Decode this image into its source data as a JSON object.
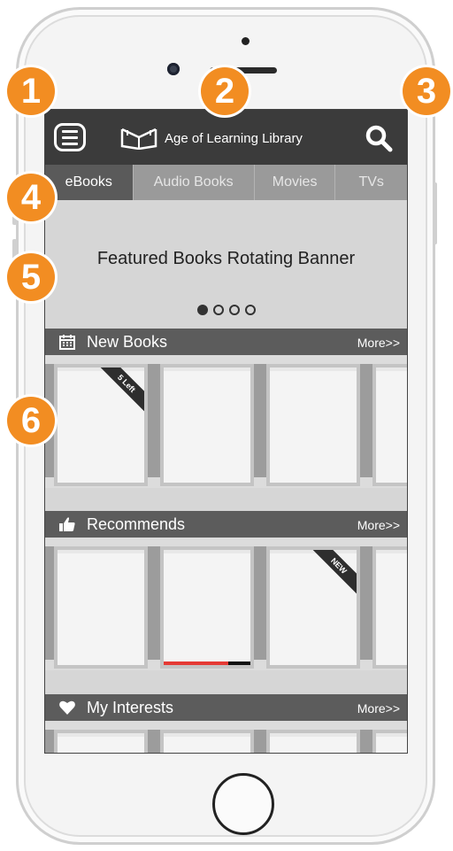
{
  "annotations": {
    "one": "1",
    "two": "2",
    "three": "3",
    "four": "4",
    "five": "5",
    "six": "6"
  },
  "header": {
    "title": "Age of Learning Library",
    "menu_icon": "hamburger-menu-icon",
    "logo_icon": "open-book-logo-icon",
    "search_icon": "search-icon"
  },
  "tabs": [
    {
      "label": "eBooks",
      "active": true
    },
    {
      "label": "Audio Books",
      "active": false
    },
    {
      "label": "Movies",
      "active": false
    },
    {
      "label": "TVs",
      "active": false
    }
  ],
  "banner": {
    "text": "Featured Books Rotating Banner",
    "slide_count": 4,
    "active_slide": 1
  },
  "sections": {
    "new_books": {
      "title": "New Books",
      "more": "More>>",
      "icon": "calendar-icon",
      "ribbon": "5 Left"
    },
    "recommends": {
      "title": "Recommends",
      "more": "More>>",
      "icon": "thumbs-up-icon",
      "ribbon": "NEW",
      "progress": 0.7
    },
    "my_interests": {
      "title": "My Interests",
      "more": "More>>",
      "icon": "heart-icon"
    }
  },
  "colors": {
    "badge": "#f28d22",
    "topbar": "#3b3b3b",
    "active_tab": "#5a5a5a",
    "progress": "#e53a35"
  }
}
